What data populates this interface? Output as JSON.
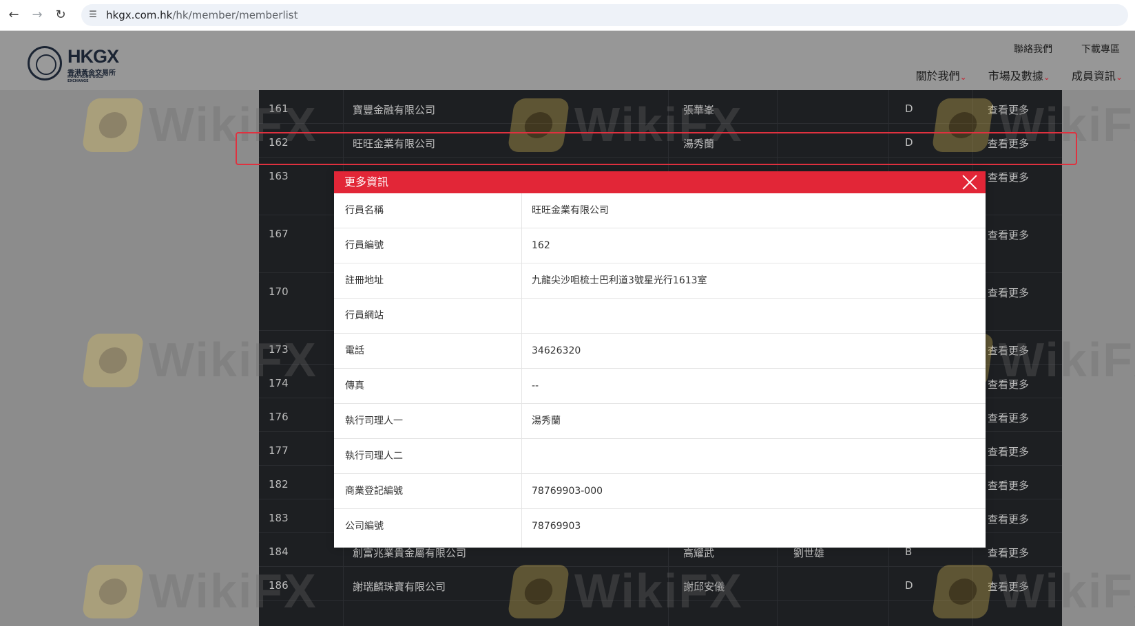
{
  "browser": {
    "url_host": "hkgx.com.hk",
    "url_path": "/hk/member/memberlist"
  },
  "site": {
    "logo_text": "HKGX",
    "logo_sub": "香港黃金交易所",
    "logo_sub_en": "HONG KONG GOLD EXCHANGE",
    "top_links": [
      "聯絡我們",
      "下載專區"
    ],
    "nav": [
      "關於我們",
      "市場及數據",
      "成員資訊"
    ]
  },
  "table": {
    "rows": [
      {
        "num": "161",
        "name": "寶豐金融有限公司",
        "p1": "張華峯",
        "p2": "",
        "grade": "D",
        "more": "查看更多"
      },
      {
        "num": "162",
        "name": "旺旺金業有限公司",
        "p1": "湯秀蘭",
        "p2": "",
        "grade": "D",
        "more": "查看更多"
      },
      {
        "num": "163",
        "name": "",
        "p1": "",
        "p2": "",
        "grade": "",
        "more": "查看更多"
      },
      {
        "num": "167",
        "name": "",
        "p1": "",
        "p2": "",
        "grade": "",
        "more": "查看更多"
      },
      {
        "num": "170",
        "name": "",
        "p1": "",
        "p2": "",
        "grade": "",
        "more": "查看更多"
      },
      {
        "num": "173",
        "name": "",
        "p1": "",
        "p2": "",
        "grade": "",
        "more": "查看更多"
      },
      {
        "num": "174",
        "name": "",
        "p1": "",
        "p2": "",
        "grade": "",
        "more": "查看更多"
      },
      {
        "num": "176",
        "name": "",
        "p1": "",
        "p2": "",
        "grade": "",
        "more": "查看更多"
      },
      {
        "num": "177",
        "name": "",
        "p1": "",
        "p2": "",
        "grade": "",
        "more": "查看更多"
      },
      {
        "num": "182",
        "name": "",
        "p1": "",
        "p2": "",
        "grade": "",
        "more": "查看更多"
      },
      {
        "num": "183",
        "name": "",
        "p1": "",
        "p2": "",
        "grade": "",
        "more": "查看更多"
      },
      {
        "num": "184",
        "name": "創富兆業貴金屬有限公司",
        "p1": "高耀武",
        "p2": "劉世雄",
        "grade": "B",
        "more": "查看更多"
      },
      {
        "num": "186",
        "name": "謝瑞麟珠寶有限公司",
        "p1": "謝邱安儀",
        "p2": "",
        "grade": "D",
        "more": "查看更多"
      }
    ]
  },
  "modal": {
    "title": "更多資訊",
    "fields": [
      {
        "label": "行員名稱",
        "value": "旺旺金業有限公司"
      },
      {
        "label": "行員編號",
        "value": "162"
      },
      {
        "label": "註冊地址",
        "value": "九龍尖沙咀梳士巴利道3號星光行1613室"
      },
      {
        "label": "行員網站",
        "value": ""
      },
      {
        "label": "電話",
        "value": "34626320"
      },
      {
        "label": "傳真",
        "value": "--"
      },
      {
        "label": "執行司理人一",
        "value": "湯秀蘭"
      },
      {
        "label": "執行司理人二",
        "value": ""
      },
      {
        "label": "商業登記編號",
        "value": "78769903-000"
      },
      {
        "label": "公司編號",
        "value": "78769903"
      }
    ]
  },
  "watermark": {
    "text": "WikiFX"
  }
}
